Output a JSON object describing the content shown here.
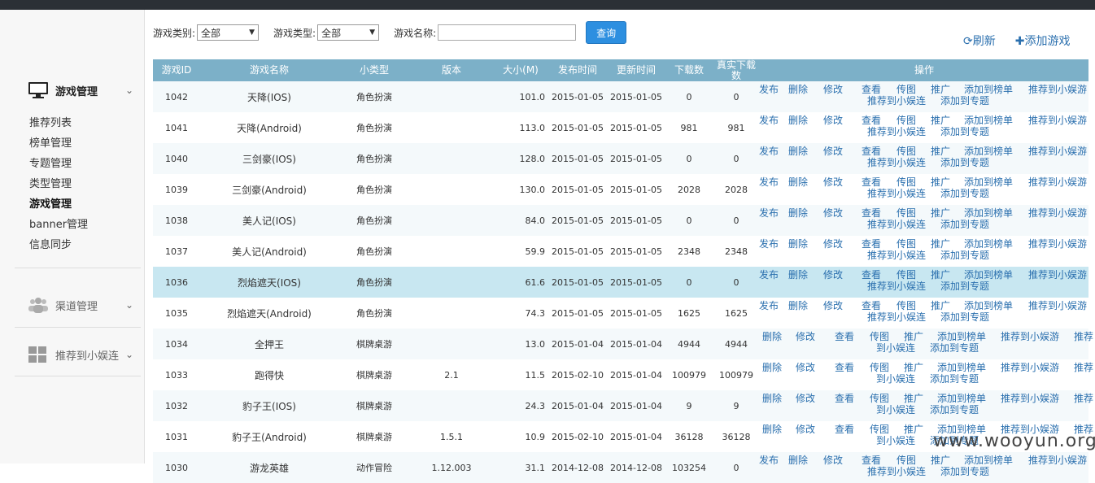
{
  "sidebar": {
    "game_section": "游戏管理",
    "items": [
      "推荐列表",
      "榜单管理",
      "专题管理",
      "类型管理",
      "游戏管理",
      "banner管理",
      "信息同步"
    ],
    "channel_section": "渠道管理",
    "promo_section": "推荐到小娱连"
  },
  "filters": {
    "category_label": "游戏类别:",
    "category_value": "全部",
    "type_label": "游戏类型:",
    "type_value": "全部",
    "name_label": "游戏名称:",
    "query_button": "查询"
  },
  "actions": {
    "refresh": "刷新",
    "add_game": "添加游戏"
  },
  "table": {
    "headers": [
      "游戏ID",
      "游戏名称",
      "小类型",
      "版本",
      "大小(M)",
      "发布时间",
      "更新时间",
      "下载数",
      "真实下载数",
      "操作"
    ],
    "rows": [
      {
        "id": "1042",
        "name": "天降(IOS)",
        "type": "角色扮演",
        "ver": "",
        "size": "101.0",
        "pub": "2015-01-05",
        "upd": "2015-01-05",
        "dl": "0",
        "real": "0",
        "v": "a"
      },
      {
        "id": "1041",
        "name": "天降(Android)",
        "type": "角色扮演",
        "ver": "",
        "size": "113.0",
        "pub": "2015-01-05",
        "upd": "2015-01-05",
        "dl": "981",
        "real": "981",
        "v": "a"
      },
      {
        "id": "1040",
        "name": "三剑豪(IOS)",
        "type": "角色扮演",
        "ver": "",
        "size": "128.0",
        "pub": "2015-01-05",
        "upd": "2015-01-05",
        "dl": "0",
        "real": "0",
        "v": "a"
      },
      {
        "id": "1039",
        "name": "三剑豪(Android)",
        "type": "角色扮演",
        "ver": "",
        "size": "130.0",
        "pub": "2015-01-05",
        "upd": "2015-01-05",
        "dl": "2028",
        "real": "2028",
        "v": "a"
      },
      {
        "id": "1038",
        "name": "美人记(IOS)",
        "type": "角色扮演",
        "ver": "",
        "size": "84.0",
        "pub": "2015-01-05",
        "upd": "2015-01-05",
        "dl": "0",
        "real": "0",
        "v": "a"
      },
      {
        "id": "1037",
        "name": "美人记(Android)",
        "type": "角色扮演",
        "ver": "",
        "size": "59.9",
        "pub": "2015-01-05",
        "upd": "2015-01-05",
        "dl": "2348",
        "real": "2348",
        "v": "a"
      },
      {
        "id": "1036",
        "name": "烈焰遮天(IOS)",
        "type": "角色扮演",
        "ver": "",
        "size": "61.6",
        "pub": "2015-01-05",
        "upd": "2015-01-05",
        "dl": "0",
        "real": "0",
        "v": "a"
      },
      {
        "id": "1035",
        "name": "烈焰遮天(Android)",
        "type": "角色扮演",
        "ver": "",
        "size": "74.3",
        "pub": "2015-01-05",
        "upd": "2015-01-05",
        "dl": "1625",
        "real": "1625",
        "v": "a"
      },
      {
        "id": "1034",
        "name": "全押王",
        "type": "棋牌桌游",
        "ver": "",
        "size": "13.0",
        "pub": "2015-01-04",
        "upd": "2015-01-04",
        "dl": "4944",
        "real": "4944",
        "v": "b"
      },
      {
        "id": "1033",
        "name": "跑得快",
        "type": "棋牌桌游",
        "ver": "2.1",
        "size": "11.5",
        "pub": "2015-02-10",
        "upd": "2015-01-04",
        "dl": "100979",
        "real": "100979",
        "v": "b"
      },
      {
        "id": "1032",
        "name": "豹子王(IOS)",
        "type": "棋牌桌游",
        "ver": "",
        "size": "24.3",
        "pub": "2015-01-04",
        "upd": "2015-01-04",
        "dl": "9",
        "real": "9",
        "v": "b"
      },
      {
        "id": "1031",
        "name": "豹子王(Android)",
        "type": "棋牌桌游",
        "ver": "1.5.1",
        "size": "10.9",
        "pub": "2015-02-10",
        "upd": "2015-01-04",
        "dl": "36128",
        "real": "36128",
        "v": "b"
      },
      {
        "id": "1030",
        "name": "游龙英雄",
        "type": "动作冒险",
        "ver": "1.12.003",
        "size": "31.1",
        "pub": "2014-12-08",
        "upd": "2014-12-08",
        "dl": "103254",
        "real": "0",
        "v": "a"
      }
    ],
    "ops_full": {
      "publish": "发布",
      "delete": "删除",
      "edit": "修改",
      "view": "查看",
      "image": "传图",
      "promote": "推广",
      "add_chart": "添加到榜单",
      "recommend": "推荐到小娱游",
      "recommend2": "推荐到小娱连",
      "add_topic": "添加到专题"
    },
    "ops_short": {
      "delete": "删除",
      "edit": "修改",
      "view": "查看",
      "image": "传图",
      "promote": "推广",
      "add_chart": "添加到榜单",
      "recommend": "推荐到小娱游",
      "recommend_cut": "推荐",
      "recommend2_cut": "到小娱连",
      "add_topic": "添加到专题"
    }
  },
  "watermark": "www.wooyun.org"
}
